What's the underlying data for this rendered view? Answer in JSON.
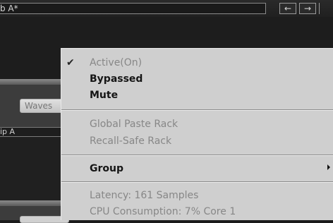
{
  "topbar": {
    "title": "b A*",
    "back_arrow": "←",
    "forward_arrow": "→"
  },
  "panel": {
    "button_label": "Waves",
    "group_label": "ip A"
  },
  "menu": {
    "check_mark": "✔",
    "items": [
      {
        "label": "Active(On)",
        "enabled": false,
        "checked": true
      },
      {
        "label": "Bypassed",
        "enabled": true
      },
      {
        "label": "Mute",
        "enabled": true
      },
      {
        "label": "Global Paste Rack",
        "enabled": false
      },
      {
        "label": "Recall-Safe Rack",
        "enabled": false
      },
      {
        "label": "Group",
        "enabled": true,
        "submenu": true
      },
      {
        "label": "Latency: 161 Samples",
        "enabled": false
      },
      {
        "label": "CPU Consumption: 7% Core 1",
        "enabled": false
      }
    ]
  }
}
